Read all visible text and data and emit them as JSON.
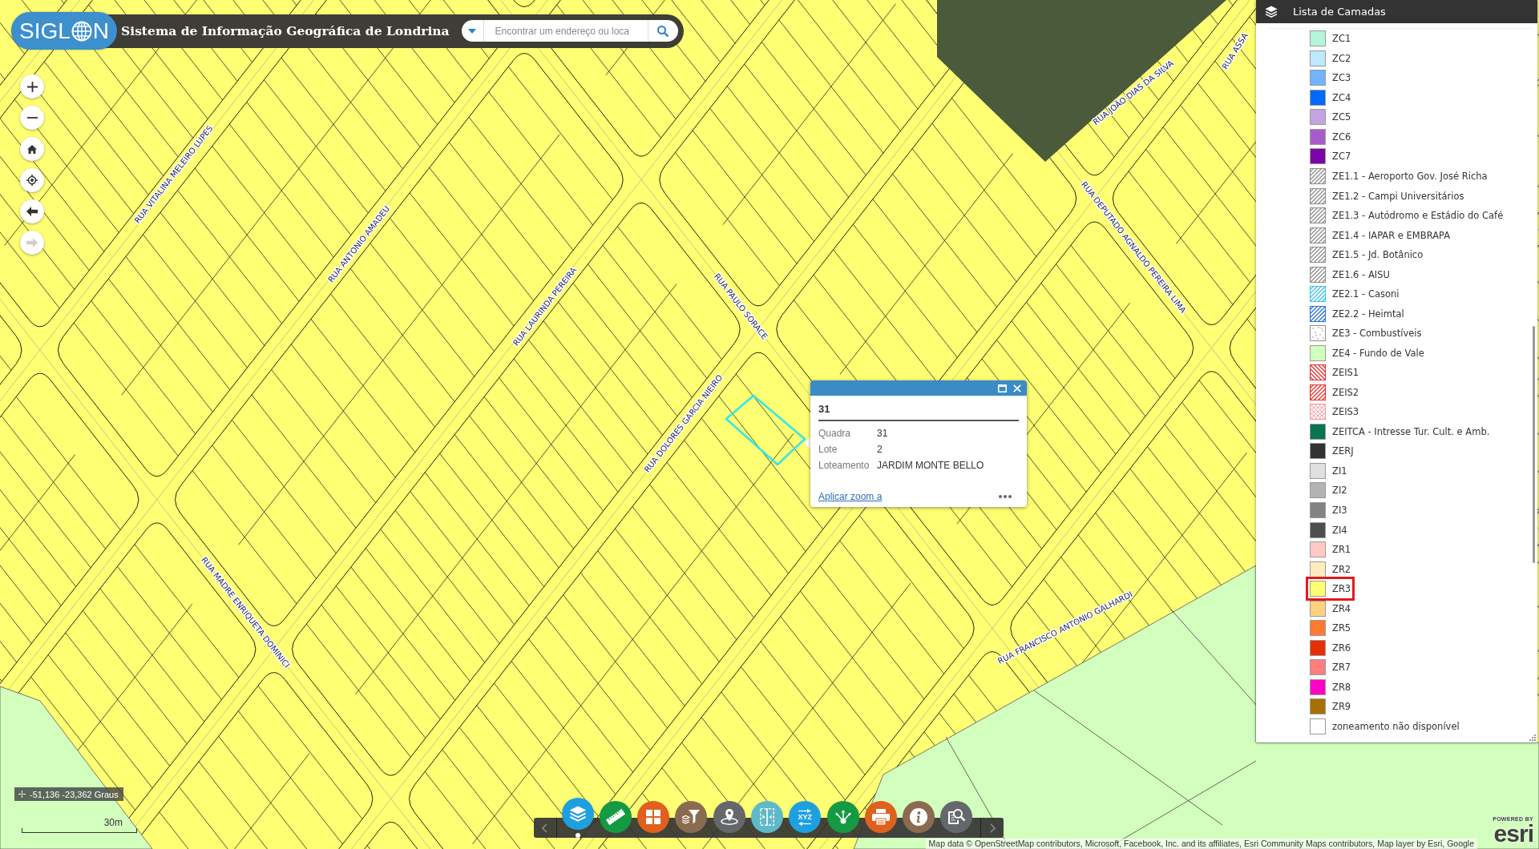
{
  "header": {
    "logo": {
      "lead": "SIGL",
      "tail": "N"
    },
    "title": "Sistema de Informação Geográfica de Londrina",
    "search": {
      "placeholder": "Encontrar um endereço ou loca"
    }
  },
  "map_controls": [
    {
      "kind": "zoom-in",
      "disabled": false
    },
    {
      "kind": "zoom-out",
      "disabled": false
    },
    {
      "kind": "home",
      "disabled": false
    },
    {
      "kind": "locate",
      "disabled": false
    },
    {
      "kind": "back",
      "disabled": false
    },
    {
      "kind": "forward",
      "disabled": true
    }
  ],
  "map": {
    "street_labels": [
      "RUA VITALINA MELEIRO LUPES",
      "RUA ANTONIO AMADEU",
      "RUA LAURINDA PEREIRA",
      "RUA PAULO SORACE",
      "RUA DOLORES GARCIA NIEIRO",
      "RUA MADRE ENRIQUETA DOMINICI",
      "RUA FRANCISCO ANTONIO GALHARDI",
      "RUA DEPUTADO AGNALDO PEREIRA LIMA",
      "RUA JOÃO DIAS DA SILVA",
      "RUA ASSA"
    ]
  },
  "popup": {
    "title": "31",
    "fields": [
      {
        "label": "Quadra",
        "value": "31"
      },
      {
        "label": "Lote",
        "value": "2"
      },
      {
        "label": "Loteamento",
        "value": "JARDIM MONTE BELLO"
      }
    ],
    "link": "Aplicar zoom a"
  },
  "layer_panel": {
    "title": "Lista de Camadas",
    "items": [
      {
        "label": "ZC1",
        "kind": "solid",
        "color": "#b4f5dc",
        "highlighted": false
      },
      {
        "label": "ZC2",
        "kind": "solid",
        "color": "#bee8fb",
        "highlighted": false
      },
      {
        "label": "ZC3",
        "kind": "solid",
        "color": "#73b2ff",
        "highlighted": false
      },
      {
        "label": "ZC4",
        "kind": "solid",
        "color": "#0068ff",
        "highlighted": false
      },
      {
        "label": "ZC5",
        "kind": "solid",
        "color": "#c4a4dc",
        "highlighted": false
      },
      {
        "label": "ZC6",
        "kind": "solid",
        "color": "#a85ccb",
        "highlighted": false
      },
      {
        "label": "ZC7",
        "kind": "solid",
        "color": "#7a05a8",
        "highlighted": false
      },
      {
        "label": "ZE1.1 - Aeroporto Gov. José Richa",
        "kind": "hatch",
        "color": "#8c8c8c",
        "highlighted": false
      },
      {
        "label": "ZE1.2 - Campi Universitários",
        "kind": "hatch",
        "color": "#8c8c8c",
        "highlighted": false
      },
      {
        "label": "ZE1.3 - Autódromo e Estádio do Café",
        "kind": "hatch",
        "color": "#8c8c8c",
        "highlighted": false
      },
      {
        "label": "ZE1.4 - IAPAR e EMBRAPA",
        "kind": "hatch",
        "color": "#8c8c8c",
        "highlighted": false
      },
      {
        "label": "ZE1.5 - Jd. Botânico",
        "kind": "hatch",
        "color": "#8c8c8c",
        "highlighted": false
      },
      {
        "label": "ZE1.6 - AISU",
        "kind": "hatch",
        "color": "#8c8c8c",
        "highlighted": false
      },
      {
        "label": "ZE2.1 - Casoni",
        "kind": "hatch",
        "color": "#3ec3ea",
        "highlighted": false
      },
      {
        "label": "ZE2.2 - Heimtal",
        "kind": "hatch",
        "color": "#2b6fdd",
        "highlighted": false
      },
      {
        "label": "ZE3 - Combustíveis",
        "kind": "dots",
        "color": "#8c8c8c",
        "highlighted": false
      },
      {
        "label": "ZE4 - Fundo de Vale",
        "kind": "solid",
        "color": "#d3ffbe",
        "highlighted": false
      },
      {
        "label": "ZEIS1",
        "kind": "backhatch",
        "color": "#e6302c",
        "highlighted": false
      },
      {
        "label": "ZEIS2",
        "kind": "hatch",
        "color": "#e6302c",
        "highlighted": false
      },
      {
        "label": "ZEIS3",
        "kind": "crosshatch",
        "color": "#f29a9a",
        "highlighted": false
      },
      {
        "label": "ZEITCA - Intresse Tur. Cult. e Amb.",
        "kind": "solid",
        "color": "#0a7350",
        "highlighted": false
      },
      {
        "label": "ZERJ",
        "kind": "solid",
        "color": "#323232",
        "highlighted": false
      },
      {
        "label": "ZI1",
        "kind": "solid",
        "color": "#e0e0e0",
        "highlighted": false
      },
      {
        "label": "ZI2",
        "kind": "solid",
        "color": "#b3b3b3",
        "highlighted": false
      },
      {
        "label": "ZI3",
        "kind": "solid",
        "color": "#838383",
        "highlighted": false
      },
      {
        "label": "ZI4",
        "kind": "solid",
        "color": "#4e4e4e",
        "highlighted": false
      },
      {
        "label": "ZR1",
        "kind": "solid",
        "color": "#ffcac4",
        "highlighted": false
      },
      {
        "label": "ZR2",
        "kind": "solid",
        "color": "#ffebc0",
        "highlighted": false
      },
      {
        "label": "ZR3",
        "kind": "solid",
        "color": "#ffff73",
        "highlighted": true
      },
      {
        "label": "ZR4",
        "kind": "solid",
        "color": "#ffd27e",
        "highlighted": false
      },
      {
        "label": "ZR5",
        "kind": "solid",
        "color": "#ff7a30",
        "highlighted": false
      },
      {
        "label": "ZR6",
        "kind": "solid",
        "color": "#e62e00",
        "highlighted": false
      },
      {
        "label": "ZR7",
        "kind": "solid",
        "color": "#ff7f7f",
        "highlighted": false
      },
      {
        "label": "ZR8",
        "kind": "solid",
        "color": "#ff00c5",
        "highlighted": false
      },
      {
        "label": "ZR9",
        "kind": "solid",
        "color": "#a87000",
        "highlighted": false
      },
      {
        "label": "zoneamento não disponível",
        "kind": "solid",
        "color": "#ffffff",
        "highlighted": false
      }
    ]
  },
  "coordinates": "-51,136 -23,362 Graus",
  "scale_bar": "30m",
  "toolbar": {
    "tools": [
      {
        "kind": "layers",
        "color": "#1ea0e0",
        "selected": true
      },
      {
        "kind": "measure",
        "color": "#149a42",
        "selected": false
      },
      {
        "kind": "gallery",
        "color": "#e0601e",
        "selected": false
      },
      {
        "kind": "filter",
        "color": "#8b6b4f",
        "selected": false
      },
      {
        "kind": "location",
        "color": "#65686b",
        "selected": false
      },
      {
        "kind": "swipe",
        "color": "#5fb9c8",
        "selected": false
      },
      {
        "kind": "coordinate",
        "color": "#1ea0e0",
        "selected": false,
        "text": "XYZ"
      },
      {
        "kind": "share",
        "color": "#149a42",
        "selected": false
      },
      {
        "kind": "print",
        "color": "#e0601e",
        "selected": false
      },
      {
        "kind": "about",
        "color": "#8b6b4f",
        "selected": false
      },
      {
        "kind": "query",
        "color": "#65686b",
        "selected": false
      }
    ]
  },
  "attribution": "Map data © OpenStreetMap contributors, Microsoft, Facebook, Inc. and its affiliates, Esri Community Maps contributors, Map layer by Esri, Google",
  "esri_logo": {
    "caption": "POWERED BY",
    "wordmark": "esri"
  }
}
